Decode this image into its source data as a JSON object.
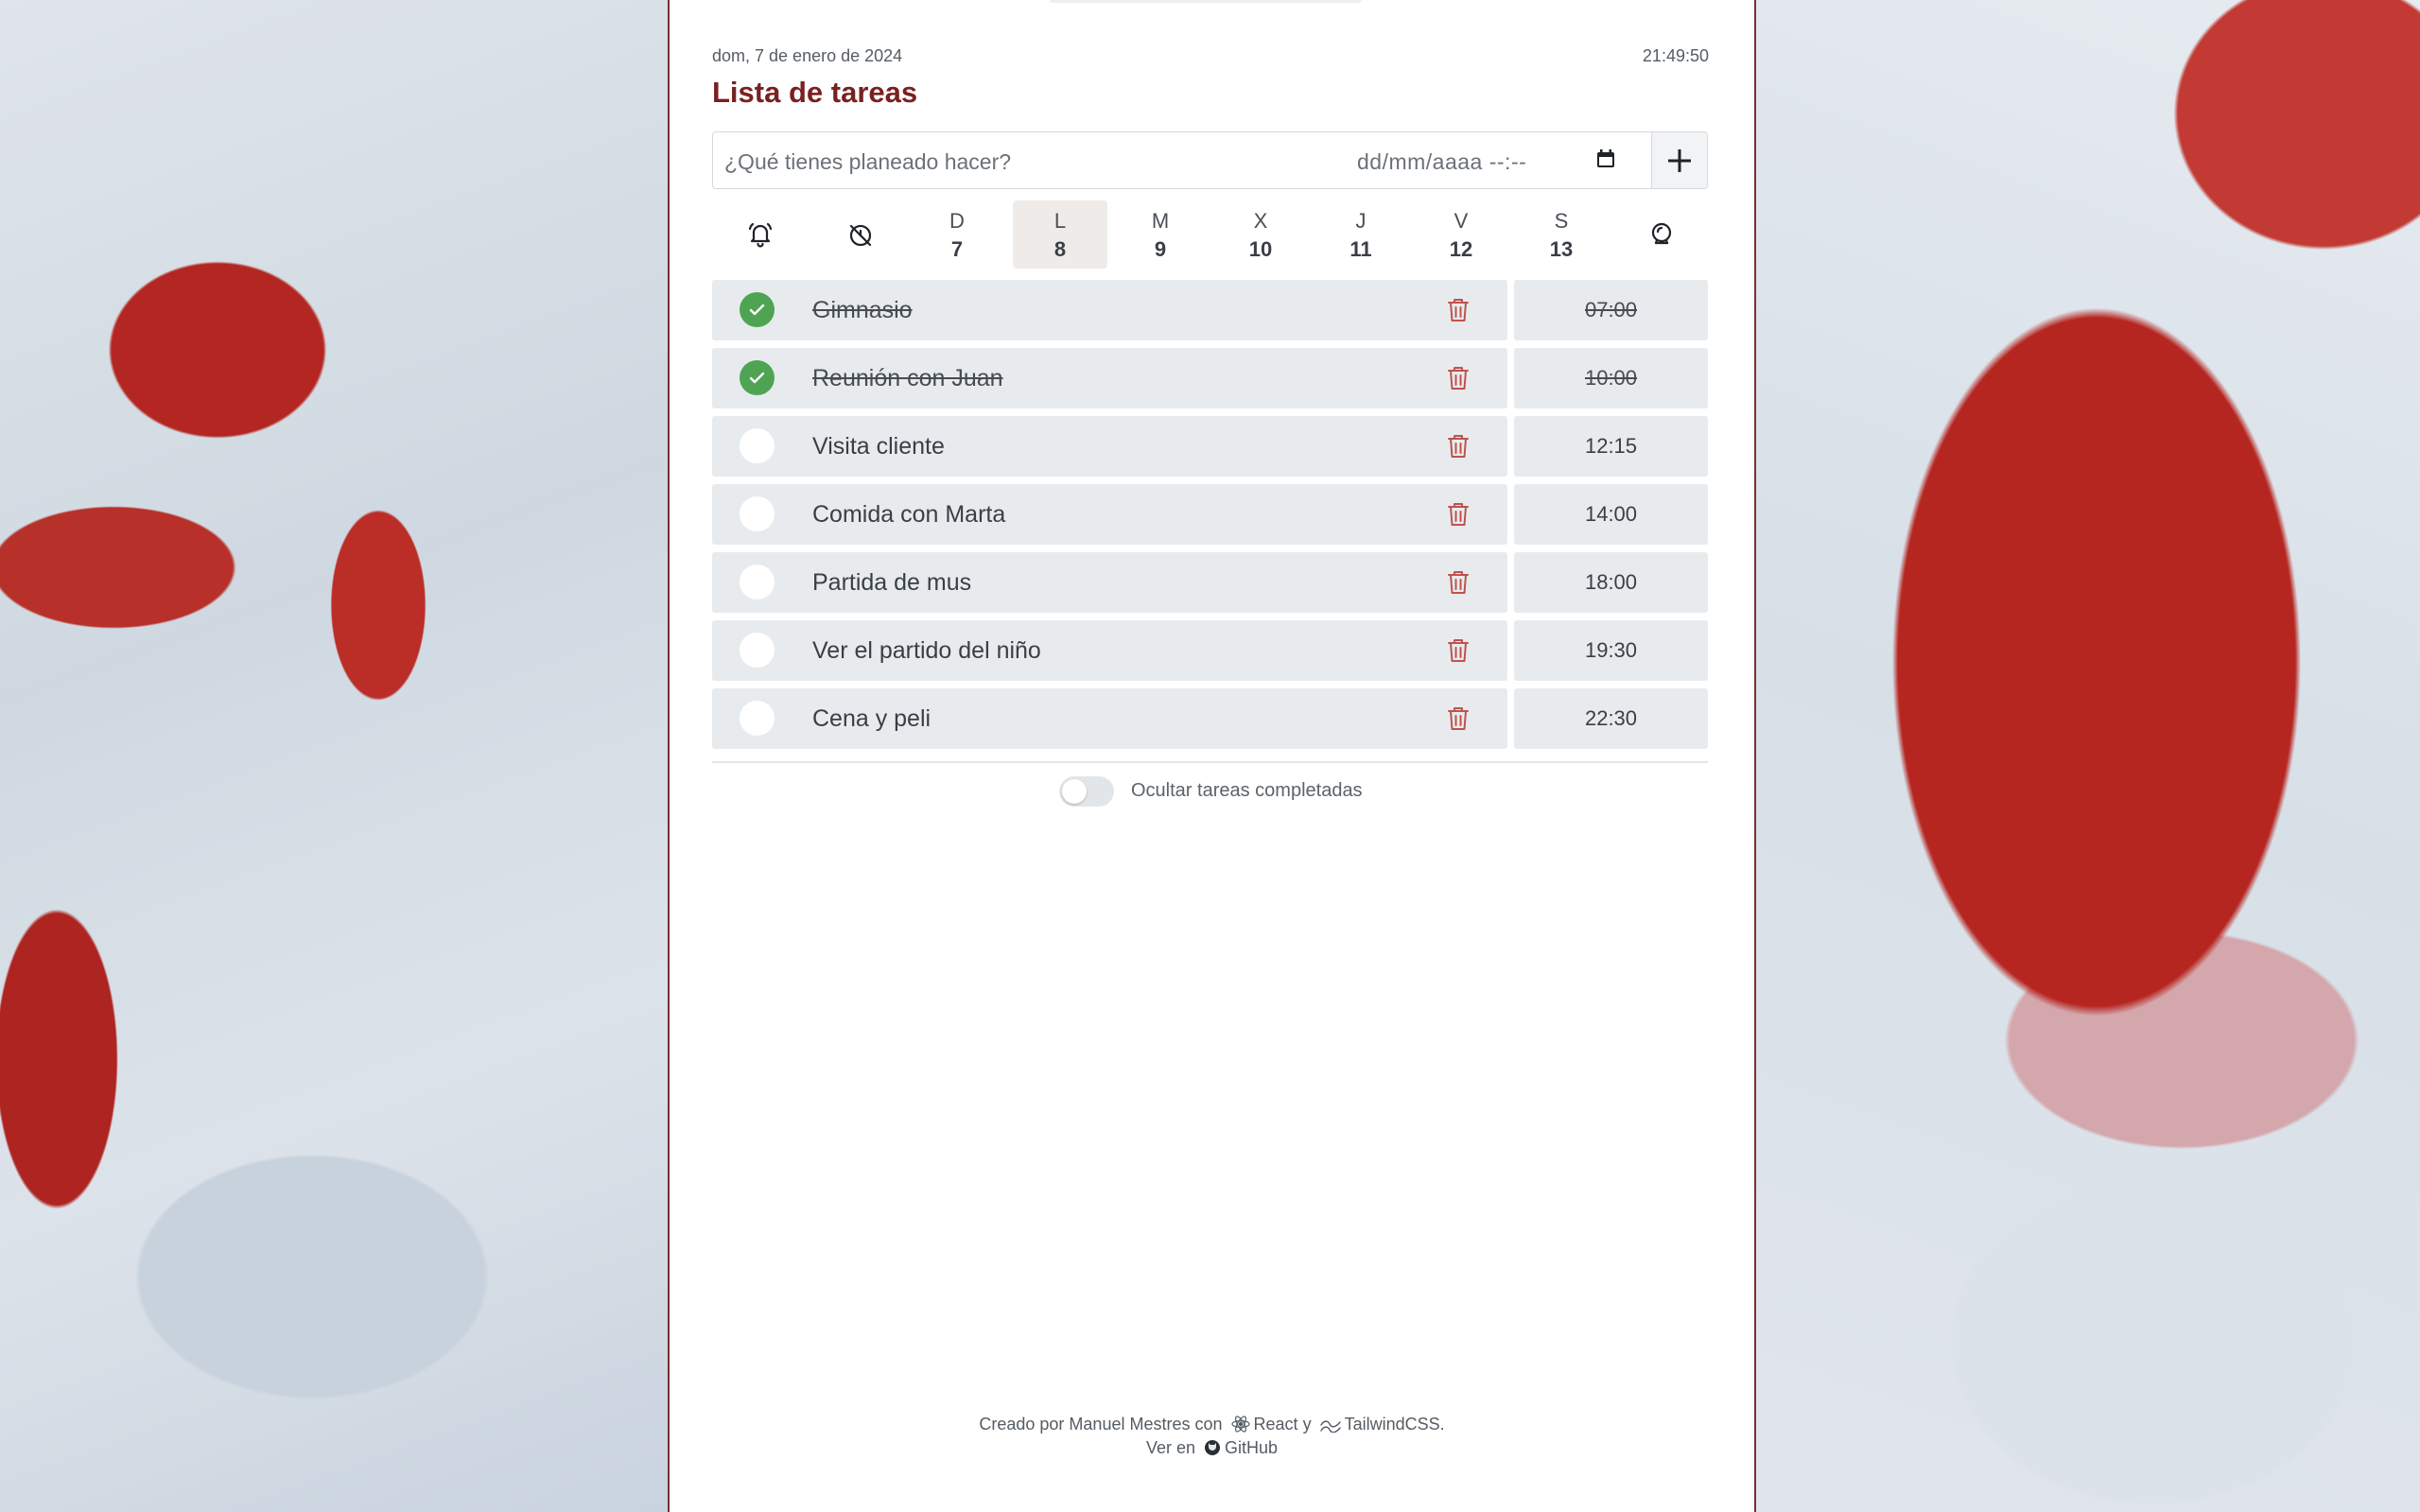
{
  "header": {
    "date": "dom, 7 de enero de 2024",
    "clock": "21:49:50",
    "title": "Lista de tareas"
  },
  "add_form": {
    "task_placeholder": "¿Qué tienes planeado hacer?",
    "date_placeholder": "dd/mm/aaaa  --:--",
    "add_icon": "plus-icon",
    "calendar_icon": "calendar-icon"
  },
  "day_strip": {
    "left_icons": [
      "bell-icon",
      "alarm-off-icon"
    ],
    "right_icon": "crystal-ball-icon",
    "days": [
      {
        "letter": "D",
        "number": "7",
        "active": false
      },
      {
        "letter": "L",
        "number": "8",
        "active": true
      },
      {
        "letter": "M",
        "number": "9",
        "active": false
      },
      {
        "letter": "X",
        "number": "10",
        "active": false
      },
      {
        "letter": "J",
        "number": "11",
        "active": false
      },
      {
        "letter": "V",
        "number": "12",
        "active": false
      },
      {
        "letter": "S",
        "number": "13",
        "active": false
      }
    ]
  },
  "tasks": [
    {
      "label": "Gimnasio",
      "time": "07:00",
      "done": true
    },
    {
      "label": "Reunión con Juan",
      "time": "10:00",
      "done": true
    },
    {
      "label": "Visita cliente",
      "time": "12:15",
      "done": false
    },
    {
      "label": "Comida con Marta",
      "time": "14:00",
      "done": false
    },
    {
      "label": "Partida de mus",
      "time": "18:00",
      "done": false
    },
    {
      "label": "Ver el partido del niño",
      "time": "19:30",
      "done": false
    },
    {
      "label": "Cena y peli",
      "time": "22:30",
      "done": false
    }
  ],
  "hide_completed": {
    "label": "Ocultar tareas completadas",
    "enabled": false
  },
  "footer": {
    "created_prefix": "Creado por Manuel Mestres con",
    "react": "React",
    "and": "y",
    "tailwind": "TailwindCSS.",
    "view_on": "Ver en",
    "github": "GitHub"
  },
  "colors": {
    "title": "#7a2020",
    "done_check": "#4ea453",
    "trash": "#c0524e",
    "row_bg": "#e8ebed",
    "active_day_bg": "#efebe8"
  }
}
